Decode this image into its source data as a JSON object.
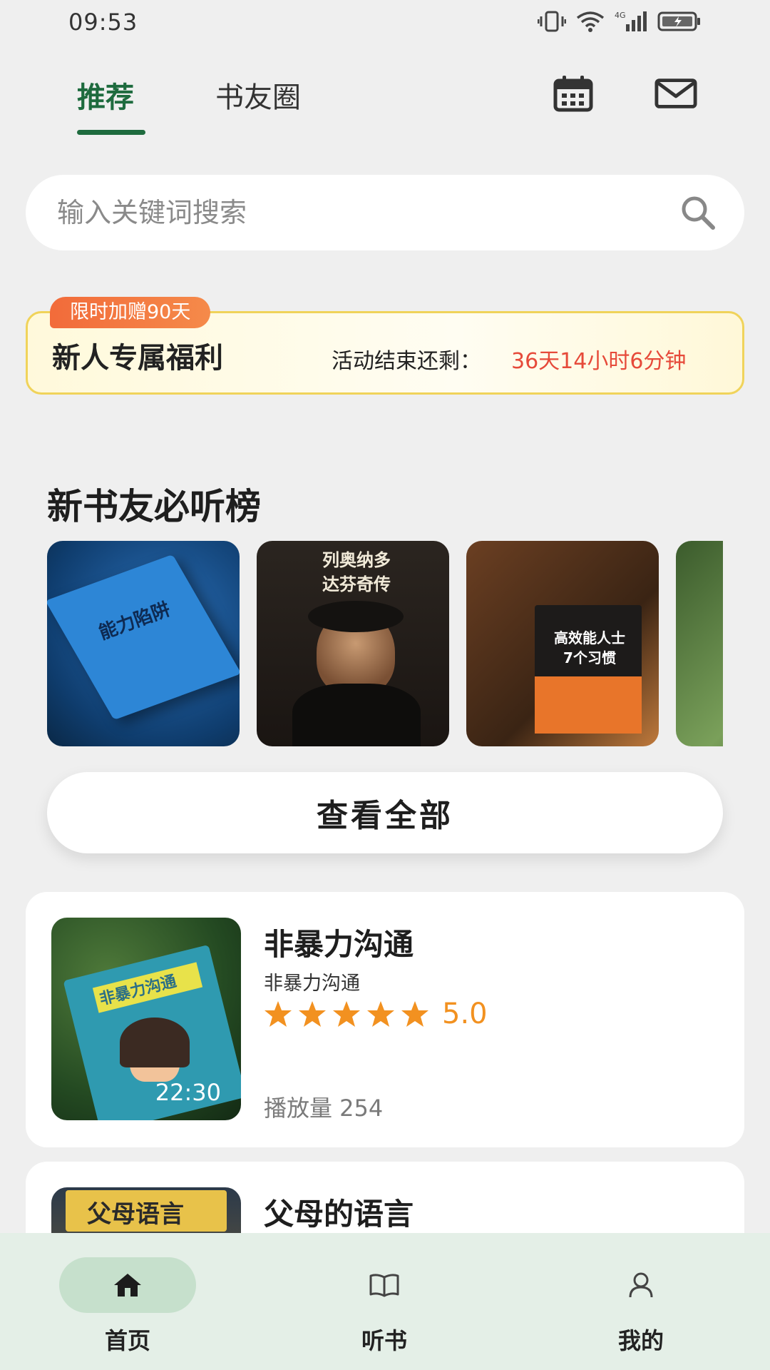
{
  "status_bar": {
    "time": "09:53",
    "network": "4G"
  },
  "header": {
    "tabs": [
      {
        "label": "推荐",
        "active": true
      },
      {
        "label": "书友圈",
        "active": false
      }
    ],
    "icons": [
      "calendar-icon",
      "mail-icon"
    ],
    "accent_color": "#1e6b3e"
  },
  "search": {
    "placeholder": "输入关键词搜索",
    "value": ""
  },
  "promo": {
    "tag": "限时加赠90天",
    "title": "新人专属福利",
    "countdown_label": "活动结束还剩：",
    "countdown_value": "36天14小时6分钟"
  },
  "new_reader_list": {
    "title": "新书友必听榜",
    "covers": [
      {
        "cover_text": "能力陷阱"
      },
      {
        "cover_text": "列奥纳多\n达芬奇传"
      },
      {
        "cover_text": "高效能人士\n7个习惯"
      },
      {
        "cover_text": ""
      }
    ],
    "view_all_label": "查看全部"
  },
  "items": [
    {
      "title": "非暴力沟通",
      "subtitle": "非暴力沟通",
      "cover_text": "非暴力沟通",
      "duration": "22:30",
      "rating": 5,
      "rating_label": "5.0",
      "plays_label": "播放量 254"
    },
    {
      "title": "父母的语言",
      "cover_text": "父母语言"
    }
  ],
  "bottom_nav": [
    {
      "label": "首页",
      "icon": "home-icon",
      "active": true
    },
    {
      "label": "听书",
      "icon": "book-icon",
      "active": false
    },
    {
      "label": "我的",
      "icon": "user-icon",
      "active": false
    }
  ]
}
